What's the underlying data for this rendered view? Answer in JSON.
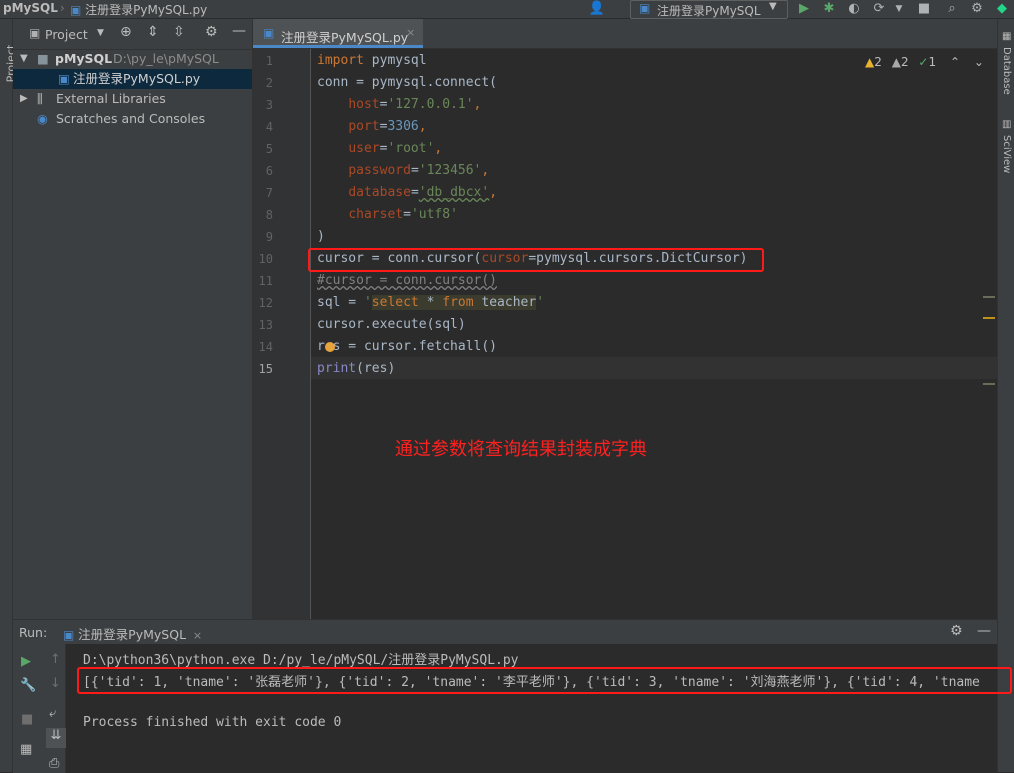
{
  "titlebar": {
    "project": "pMySQL",
    "file": "注册登录PyMySQL.py",
    "run_config": "注册登录PyMySQL"
  },
  "left_stripe": {
    "project_tab": "Project"
  },
  "right_stripe": {
    "database_tab": "Database",
    "sciview_tab": "SciView"
  },
  "project_panel": {
    "title": "Project",
    "root_name": "pMySQL",
    "root_path": "D:\\py_le\\pMySQL",
    "file": "注册登录PyMySQL.py",
    "external_libraries": "External Libraries",
    "scratches": "Scratches and Consoles"
  },
  "editor": {
    "tab_label": "注册登录PyMySQL.py",
    "inspections": {
      "warnings": "2",
      "weak_warnings": "2",
      "ok": "1"
    },
    "line_numbers": [
      "1",
      "2",
      "3",
      "4",
      "5",
      "6",
      "7",
      "8",
      "9",
      "10",
      "11",
      "12",
      "13",
      "14",
      "15"
    ],
    "code": {
      "l1_kw": "import",
      "l1_rest": " pymysql",
      "l2": "conn = pymysql.connect(",
      "l3_param": "host",
      "l3_val": "'127.0.0.1'",
      "l4_param": "port",
      "l4_val": "3306",
      "l5_param": "user",
      "l5_val": "'root'",
      "l6_param": "password",
      "l6_val": "'123456'",
      "l7_param": "database",
      "l7_val": "'db_dbcx'",
      "l8_param": "charset",
      "l8_val": "'utf8'",
      "l9": ")",
      "l10_a": "cursor = conn.cursor(",
      "l10_param": "cursor",
      "l10_b": "=pymysql.cursors.DictCursor)",
      "l11": "#cursor = conn.cursor()",
      "l12_a": "sql = ",
      "l12_q1": "'",
      "l12_select": "select",
      "l12_mid": " * ",
      "l12_from": "from",
      "l12_table": " teacher",
      "l12_q2": "'",
      "l13": "cursor.execute(sql)",
      "l14": "res = cursor.fetchall()",
      "l15_kw": "print",
      "l15_rest": "(res)"
    },
    "annotation": "通过参数将查询结果封装成字典"
  },
  "run": {
    "label": "Run:",
    "tab": "注册登录PyMySQL",
    "command": "D:\\python36\\python.exe D:/py_le/pMySQL/注册登录PyMySQL.py",
    "output": "[{'tid': 1, 'tname': '张磊老师'}, {'tid': 2, 'tname': '李平老师'}, {'tid': 3, 'tname': '刘海燕老师'}, {'tid': 4, 'tname",
    "exit": "Process finished with exit code 0"
  }
}
